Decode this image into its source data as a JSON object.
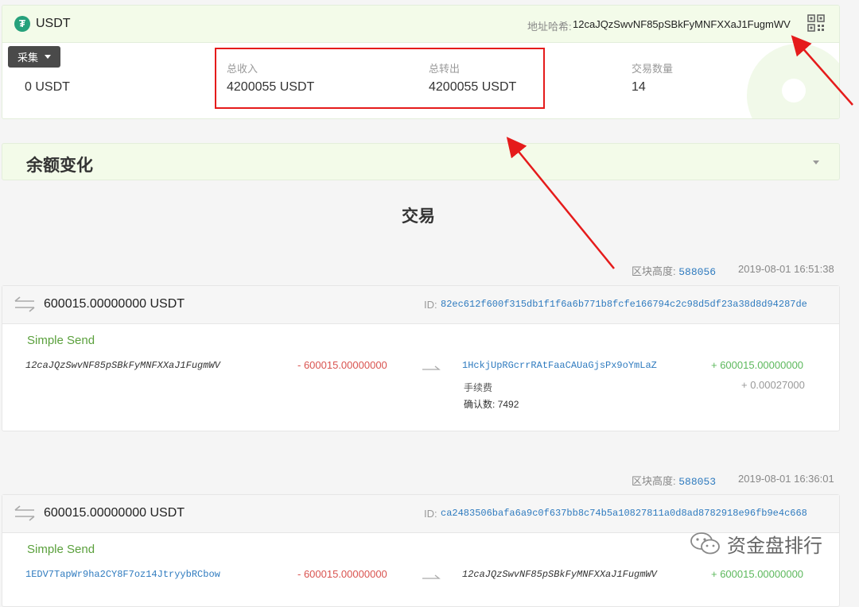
{
  "header": {
    "token": "USDT",
    "address_label": "地址哈希:",
    "address": "12caJQzSwvNF85pSBkFyMNFXXaJ1FugmWV",
    "icons": {
      "token": "tether-icon",
      "qr": "qr-code-icon"
    }
  },
  "collect_button": {
    "label": "采集"
  },
  "stats": {
    "balance": {
      "value": "0 USDT"
    },
    "total_in": {
      "label": "总收入",
      "value": "4200055 USDT"
    },
    "total_out": {
      "label": "总转出",
      "value": "4200055 USDT"
    },
    "tx_count": {
      "label": "交易数量",
      "value": "14"
    }
  },
  "balance_section": {
    "title": "余额变化"
  },
  "transactions_heading": "交易",
  "colors": {
    "accent_green": "#5aa03c",
    "link_blue": "#2f7bbf",
    "negative_red": "#d9534f",
    "positive_green": "#5cb85c",
    "annotation_red": "#e51b1b",
    "tether": "#26a17b"
  },
  "transactions": [
    {
      "block_label": "区块高度:",
      "block_height": "588056",
      "time": "2019-08-01 16:51:38",
      "amount": "600015.00000000 USDT",
      "id_label": "ID:",
      "id": "82ec612f600f315db1f1f6a6b771b8fcfe166794c2c98d5df23a38d8d94287de",
      "type": "Simple Send",
      "from": "12caJQzSwvNF85pSBkFyMNFXXaJ1FugmWV",
      "out_amount": "- 600015.00000000",
      "to": "1HckjUpRGcrrRAtFaaCAUaGjsPx9oYmLaZ",
      "in_amount": "+ 600015.00000000",
      "fee_label": "手续费",
      "fee": "+ 0.00027000",
      "confirmations_label": "确认数:",
      "confirmations": "7492"
    },
    {
      "block_label": "区块高度:",
      "block_height": "588053",
      "time": "2019-08-01 16:36:01",
      "amount": "600015.00000000 USDT",
      "id_label": "ID:",
      "id": "ca2483506bafa6a9c0f637bb8c74b5a10827811a0d8ad8782918e96fb9e4c668",
      "type": "Simple Send",
      "from": "1EDV7TapWr9ha2CY8F7oz14JtryybRCbow",
      "out_amount": "- 600015.00000000",
      "to": "12caJQzSwvNF85pSBkFyMNFXXaJ1FugmWV",
      "in_amount": "+ 600015.00000000"
    }
  ],
  "watermark": {
    "text": "资金盘排行",
    "icon": "wechat-icon"
  }
}
